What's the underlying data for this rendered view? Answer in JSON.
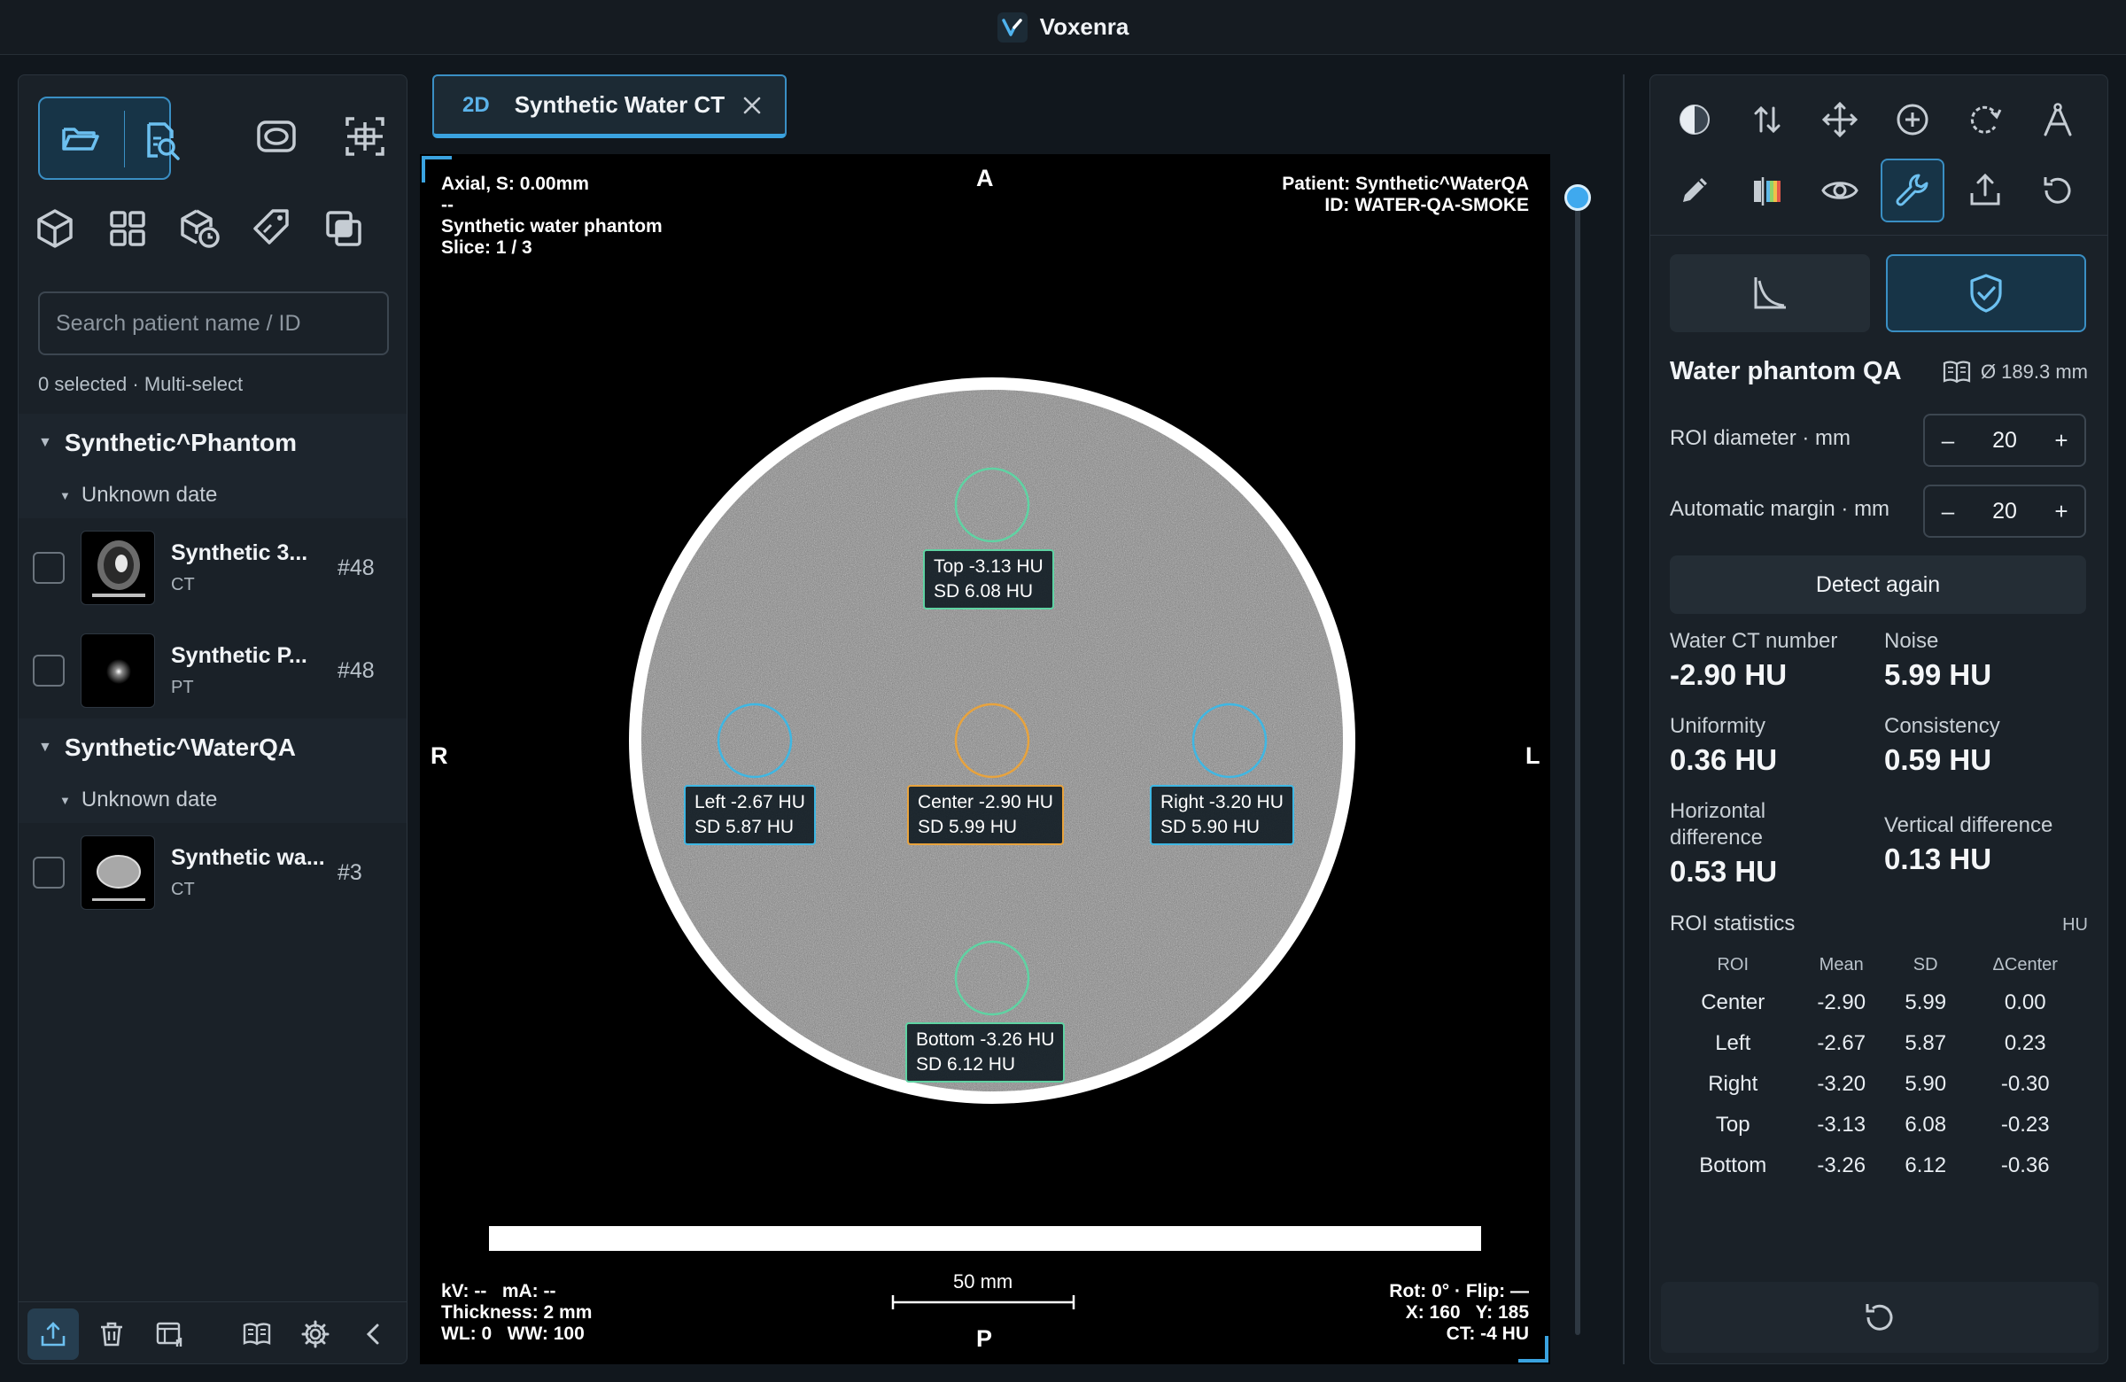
{
  "app": {
    "title": "Voxenra"
  },
  "left": {
    "search_placeholder": "Search patient name / ID",
    "selection_status": "0 selected · Multi-select",
    "groups": [
      {
        "name": "Synthetic^Phantom",
        "date": "Unknown date",
        "series": [
          {
            "name": "Synthetic 3...",
            "modality": "CT",
            "count": "#48"
          },
          {
            "name": "Synthetic P...",
            "modality": "PT",
            "count": "#48"
          }
        ]
      },
      {
        "name": "Synthetic^WaterQA",
        "date": "Unknown date",
        "series": [
          {
            "name": "Synthetic wa...",
            "modality": "CT",
            "count": "#3"
          }
        ]
      }
    ]
  },
  "tab": {
    "mode": "2D",
    "title": "Synthetic Water CT"
  },
  "viewport": {
    "top_left": {
      "line1": "Axial, S: 0.00mm",
      "line2": "--",
      "line3": "Synthetic water phantom",
      "line4": "Slice: 1 / 3"
    },
    "top_right": {
      "line1": "Patient: Synthetic^WaterQA",
      "line2": "ID: WATER-QA-SMOKE"
    },
    "bottom_left": {
      "line1": "kV: --   mA: --",
      "line2": "Thickness: 2 mm",
      "line3": "WL: 0   WW: 100"
    },
    "bottom_right": {
      "line1": "Rot: 0° · Flip: —",
      "line2": "X: 160   Y: 185",
      "line3": "CT: -4 HU"
    },
    "orientation": {
      "top": "A",
      "bottom": "P",
      "left": "R",
      "right": "L"
    },
    "scale_bar": "50 mm",
    "rois": [
      {
        "id": "top",
        "line1": "Top  -3.13 HU",
        "line2": "SD  6.08 HU",
        "color": "#5fd3a3"
      },
      {
        "id": "left",
        "line1": "Left  -2.67 HU",
        "line2": "SD  5.87 HU",
        "color": "#3fb7e3"
      },
      {
        "id": "center",
        "line1": "Center  -2.90 HU",
        "line2": "SD  5.99 HU",
        "color": "#e8a33d"
      },
      {
        "id": "right",
        "line1": "Right  -3.20 HU",
        "line2": "SD  5.90 HU",
        "color": "#3fb7e3"
      },
      {
        "id": "bottom",
        "line1": "Bottom  -3.26 HU",
        "line2": "SD  6.12 HU",
        "color": "#5fd3a3"
      }
    ]
  },
  "right": {
    "qa": {
      "title": "Water phantom QA",
      "diameter": "Ø 189.3 mm",
      "roi_diameter": {
        "label": "ROI diameter · mm",
        "minus": "–",
        "value": "20",
        "plus": "+"
      },
      "auto_margin": {
        "label": "Automatic margin · mm",
        "minus": "–",
        "value": "20",
        "plus": "+"
      },
      "detect_label": "Detect again",
      "metrics": {
        "water_ct": {
          "label": "Water CT number",
          "value": "-2.90 HU"
        },
        "noise": {
          "label": "Noise",
          "value": "5.99 HU"
        },
        "uniformity": {
          "label": "Uniformity",
          "value": "0.36 HU"
        },
        "consistency": {
          "label": "Consistency",
          "value": "0.59 HU"
        },
        "horizontal": {
          "label": "Horizontal difference",
          "value": "0.53 HU"
        },
        "vertical": {
          "label": "Vertical difference",
          "value": "0.13 HU"
        }
      },
      "stats": {
        "title": "ROI statistics",
        "unit": "HU",
        "headers": [
          "ROI",
          "Mean",
          "SD",
          "ΔCenter"
        ],
        "rows": [
          [
            "Center",
            "-2.90",
            "5.99",
            "0.00"
          ],
          [
            "Left",
            "-2.67",
            "5.87",
            "0.23"
          ],
          [
            "Right",
            "-3.20",
            "5.90",
            "-0.30"
          ],
          [
            "Top",
            "-3.13",
            "6.08",
            "-0.23"
          ],
          [
            "Bottom",
            "-3.26",
            "6.12",
            "-0.36"
          ]
        ]
      }
    }
  },
  "colors": {
    "accent": "#3aa3e0",
    "roi_center": "#e8a33d",
    "roi_lateral": "#3fb7e3",
    "roi_vertical": "#5fd3a3"
  }
}
